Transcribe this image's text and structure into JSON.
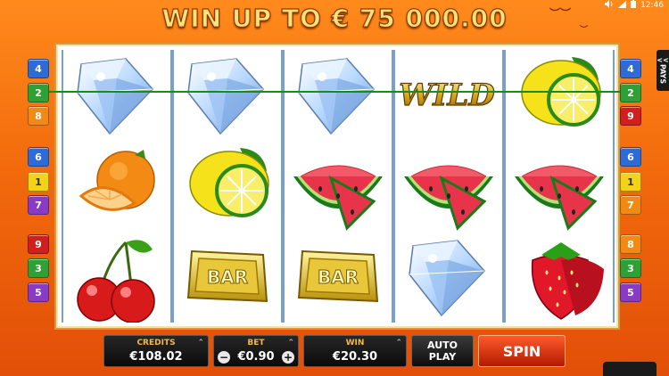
{
  "status_bar": {
    "time": "12:46"
  },
  "header": {
    "title": "WIN UP TO € 75 000.00"
  },
  "pays_tab": {
    "chevron": "<<",
    "label": "PAYS"
  },
  "left_lines": [
    {
      "n": "4",
      "color": "blue"
    },
    {
      "n": "2",
      "color": "green"
    },
    {
      "n": "8",
      "color": "orange"
    },
    {
      "n": "6",
      "color": "blue"
    },
    {
      "n": "1",
      "color": "yellow"
    },
    {
      "n": "7",
      "color": "purple"
    },
    {
      "n": "9",
      "color": "red"
    },
    {
      "n": "3",
      "color": "green"
    },
    {
      "n": "5",
      "color": "purple"
    }
  ],
  "right_lines": [
    {
      "n": "4",
      "color": "blue"
    },
    {
      "n": "2",
      "color": "green"
    },
    {
      "n": "9",
      "color": "red"
    },
    {
      "n": "6",
      "color": "blue"
    },
    {
      "n": "1",
      "color": "yellow"
    },
    {
      "n": "7",
      "color": "orange"
    },
    {
      "n": "8",
      "color": "orange"
    },
    {
      "n": "3",
      "color": "green"
    },
    {
      "n": "5",
      "color": "purple"
    }
  ],
  "reels": [
    [
      "diamond",
      "orange",
      "cherry"
    ],
    [
      "diamond",
      "lemon",
      "bar"
    ],
    [
      "diamond",
      "watermelon",
      "bar"
    ],
    [
      "wild",
      "watermelon",
      "diamond"
    ],
    [
      "lemon",
      "watermelon",
      "strawberry"
    ]
  ],
  "wild_label": "WILD",
  "bar_label": "BAR",
  "controls": {
    "credits_label": "CREDITS",
    "credits_value": "€108.02",
    "bet_label": "BET",
    "bet_value": "€0.90",
    "bet_minus": "−",
    "bet_plus": "+",
    "win_label": "WIN",
    "win_value": "€20.30",
    "autoplay_line1": "AUTO",
    "autoplay_line2": "PLAY",
    "spin_label": "SPIN"
  },
  "colors": {
    "accent": "#f26a0c",
    "payline": "#1a8a1a",
    "spin": "#d8301a"
  }
}
